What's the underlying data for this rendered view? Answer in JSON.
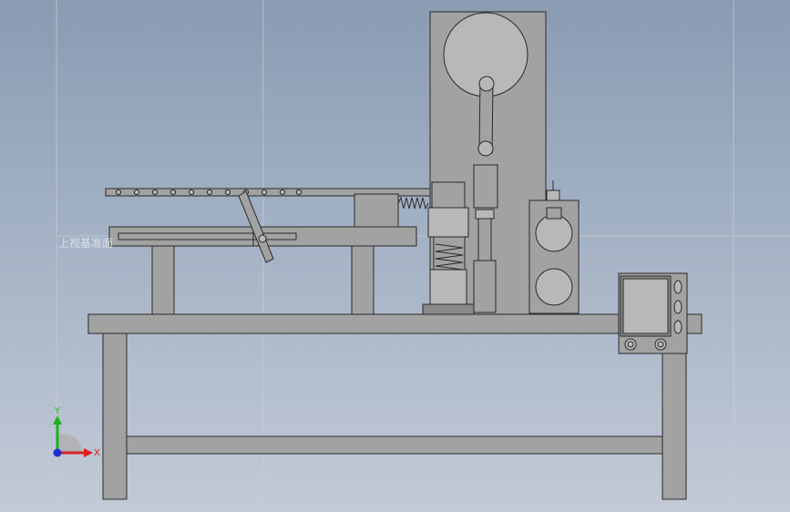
{
  "plane_label": "上视基准面",
  "triad": {
    "x_label": "X",
    "y_label": "Y",
    "x_color": "#e02020",
    "y_color": "#20b020",
    "z_color": "#2030d0"
  },
  "colors": {
    "background_top": "#8a9bb2",
    "background_bottom": "#c2cad6",
    "part_fill": "#a2a2a2",
    "edge": "#2a2a2a"
  }
}
